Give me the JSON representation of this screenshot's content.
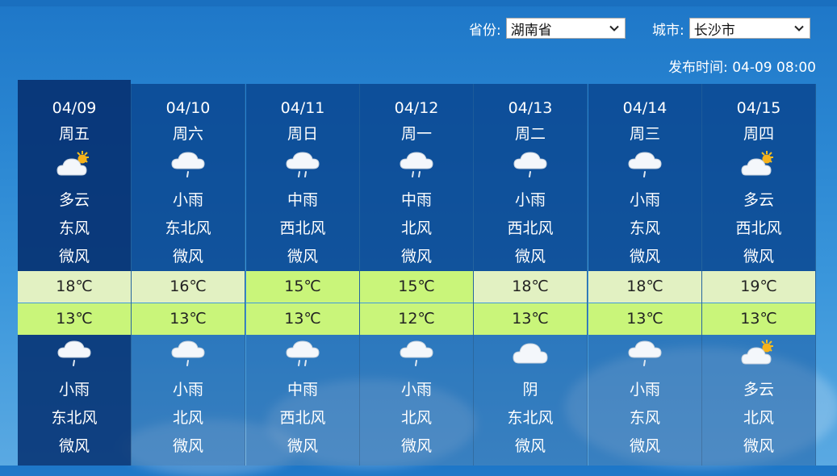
{
  "filters": {
    "province_label": "省份:",
    "province_value": "湖南省",
    "city_label": "城市:",
    "city_value": "长沙市"
  },
  "publish": {
    "label": "发布时间:",
    "time": "04-09 08:00"
  },
  "days": [
    {
      "date": "04/09",
      "weekday": "周五",
      "day_icon": "partly-cloudy-icon",
      "day_weather": "多云",
      "day_wind_dir": "东风",
      "day_wind_force": "微风",
      "high": "18℃",
      "low": "13℃",
      "high_bg": "#e2f1c2",
      "low_bg": "#c9f57a",
      "night_icon": "light-rain-icon",
      "night_weather": "小雨",
      "night_wind_dir": "东北风",
      "night_wind_force": "微风"
    },
    {
      "date": "04/10",
      "weekday": "周六",
      "day_icon": "light-rain-icon",
      "day_weather": "小雨",
      "day_wind_dir": "东北风",
      "day_wind_force": "微风",
      "high": "16℃",
      "low": "13℃",
      "high_bg": "#e2f1c2",
      "low_bg": "#c9f57a",
      "night_icon": "light-rain-icon",
      "night_weather": "小雨",
      "night_wind_dir": "北风",
      "night_wind_force": "微风"
    },
    {
      "date": "04/11",
      "weekday": "周日",
      "day_icon": "moderate-rain-icon",
      "day_weather": "中雨",
      "day_wind_dir": "西北风",
      "day_wind_force": "微风",
      "high": "15℃",
      "low": "13℃",
      "high_bg": "#c9f57a",
      "low_bg": "#c9f57a",
      "night_icon": "moderate-rain-icon",
      "night_weather": "中雨",
      "night_wind_dir": "西北风",
      "night_wind_force": "微风"
    },
    {
      "date": "04/12",
      "weekday": "周一",
      "day_icon": "moderate-rain-icon",
      "day_weather": "中雨",
      "day_wind_dir": "北风",
      "day_wind_force": "微风",
      "high": "15℃",
      "low": "12℃",
      "high_bg": "#c9f57a",
      "low_bg": "#c9f57a",
      "night_icon": "light-rain-icon",
      "night_weather": "小雨",
      "night_wind_dir": "北风",
      "night_wind_force": "微风"
    },
    {
      "date": "04/13",
      "weekday": "周二",
      "day_icon": "light-rain-icon",
      "day_weather": "小雨",
      "day_wind_dir": "西北风",
      "day_wind_force": "微风",
      "high": "18℃",
      "low": "13℃",
      "high_bg": "#e2f1c2",
      "low_bg": "#c9f57a",
      "night_icon": "overcast-icon",
      "night_weather": "阴",
      "night_wind_dir": "东北风",
      "night_wind_force": "微风"
    },
    {
      "date": "04/14",
      "weekday": "周三",
      "day_icon": "light-rain-icon",
      "day_weather": "小雨",
      "day_wind_dir": "东风",
      "day_wind_force": "微风",
      "high": "18℃",
      "low": "13℃",
      "high_bg": "#e2f1c2",
      "low_bg": "#c9f57a",
      "night_icon": "light-rain-icon",
      "night_weather": "小雨",
      "night_wind_dir": "东风",
      "night_wind_force": "微风"
    },
    {
      "date": "04/15",
      "weekday": "周四",
      "day_icon": "partly-cloudy-icon",
      "day_weather": "多云",
      "day_wind_dir": "西北风",
      "day_wind_force": "微风",
      "high": "19℃",
      "low": "13℃",
      "high_bg": "#e2f1c2",
      "low_bg": "#c9f57a",
      "night_icon": "partly-cloudy-icon",
      "night_weather": "多云",
      "night_wind_dir": "北风",
      "night_wind_force": "微风"
    }
  ]
}
